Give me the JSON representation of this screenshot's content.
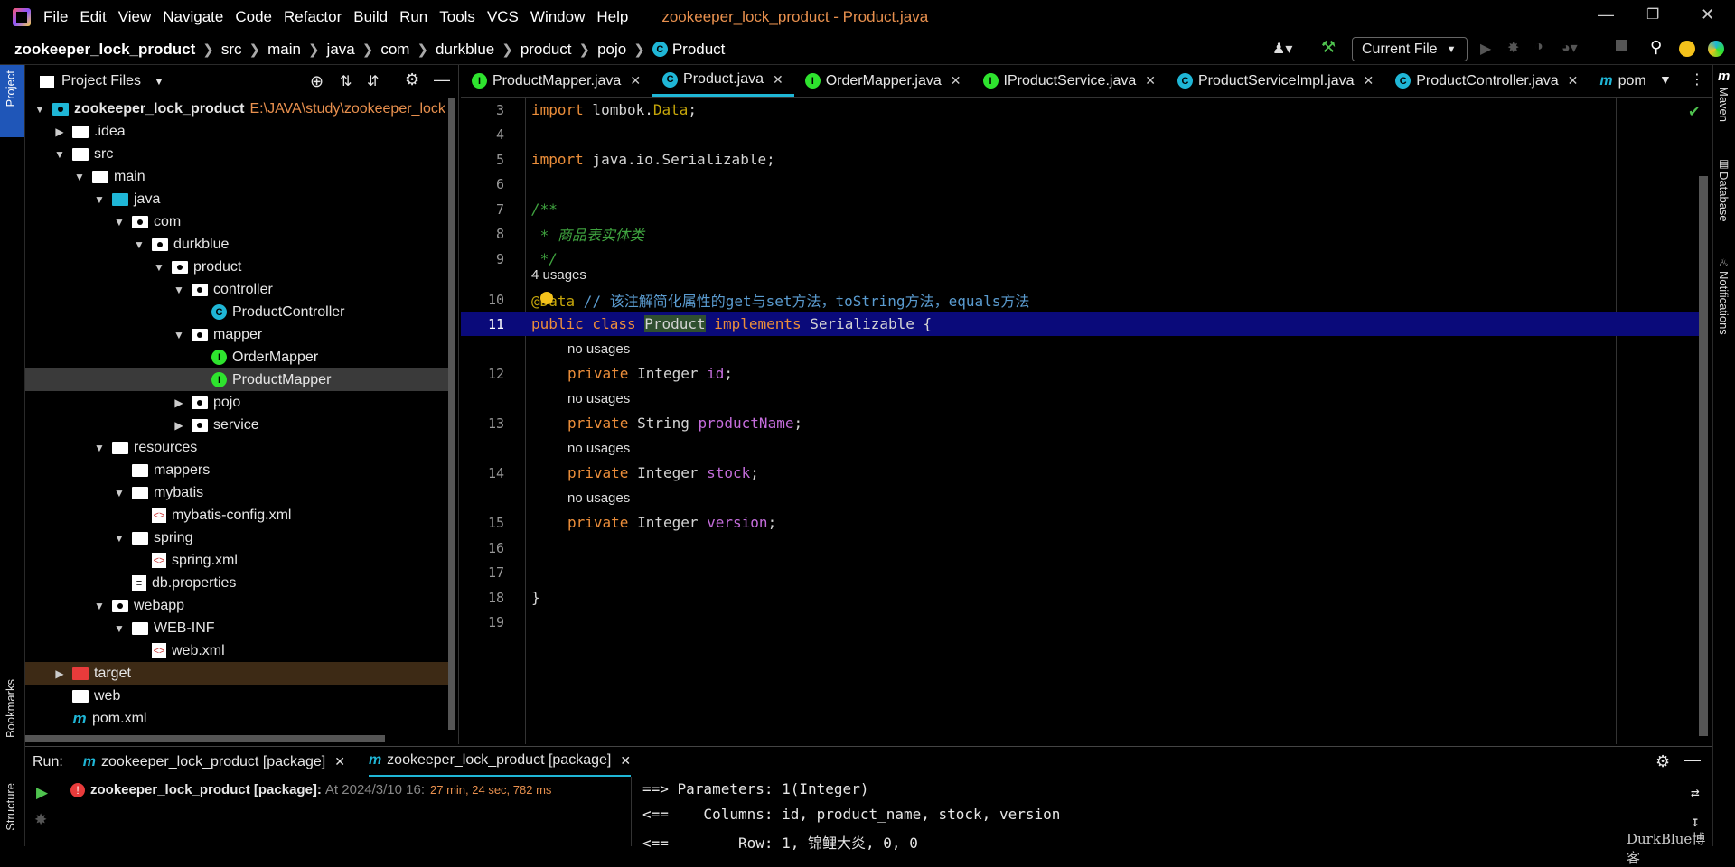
{
  "titlebar": {
    "menu": [
      "File",
      "Edit",
      "View",
      "Navigate",
      "Code",
      "Refactor",
      "Build",
      "Run",
      "Tools",
      "VCS",
      "Window",
      "Help"
    ],
    "title": "zookeeper_lock_product - Product.java"
  },
  "navbar": {
    "crumbs": [
      "zookeeper_lock_product",
      "src",
      "main",
      "java",
      "com",
      "durkblue",
      "product",
      "pojo",
      "Product"
    ],
    "run_config": "Current File"
  },
  "project": {
    "header": "Project Files",
    "root_path": "E:\\JAVA\\study\\zookeeper_lock",
    "items": [
      {
        "label": "zookeeper_lock_product"
      },
      {
        "label": ".idea"
      },
      {
        "label": "src"
      },
      {
        "label": "main"
      },
      {
        "label": "java"
      },
      {
        "label": "com"
      },
      {
        "label": "durkblue"
      },
      {
        "label": "product"
      },
      {
        "label": "controller"
      },
      {
        "label": "ProductController"
      },
      {
        "label": "mapper"
      },
      {
        "label": "OrderMapper"
      },
      {
        "label": "ProductMapper"
      },
      {
        "label": "pojo"
      },
      {
        "label": "service"
      },
      {
        "label": "resources"
      },
      {
        "label": "mappers"
      },
      {
        "label": "mybatis"
      },
      {
        "label": "mybatis-config.xml"
      },
      {
        "label": "spring"
      },
      {
        "label": "spring.xml"
      },
      {
        "label": "db.properties"
      },
      {
        "label": "webapp"
      },
      {
        "label": "WEB-INF"
      },
      {
        "label": "web.xml"
      },
      {
        "label": "target"
      },
      {
        "label": "web"
      },
      {
        "label": "pom.xml"
      }
    ]
  },
  "tabs": [
    "ProductMapper.java",
    "Product.java",
    "OrderMapper.java",
    "IProductService.java",
    "ProductServiceImpl.java",
    "ProductController.java",
    "pom."
  ],
  "editor": {
    "line_numbers": [
      "3",
      "4",
      "5",
      "6",
      "7",
      "8",
      "9",
      "10",
      "11",
      "12",
      "13",
      "14",
      "15",
      "16",
      "17",
      "18",
      "19"
    ],
    "usages_4": "4 usages",
    "no_usages": "no usages",
    "l3_kw": "import",
    "l3_rest": " lombok.",
    "l3_data": "Data",
    "l3_end": ";",
    "l5_kw": "import",
    "l5_rest": " java.io.Serializable;",
    "l7": "/**",
    "l8": " * 商品表实体类",
    "l9": " */",
    "l10_ann": "@Data",
    "l10_cm": " // 该注解简化属性的get与set方法，toString方法，equals方法",
    "l11_kw1": "public class ",
    "l11_cls": "Product",
    "l11_kw2": " implements ",
    "l11_rest": "Serializable {",
    "f_private": "private ",
    "f12_type": "Integer ",
    "f12_name": "id",
    "f13_type": "String ",
    "f13_name": "productName",
    "f14_type": "Integer ",
    "f14_name": "stock",
    "f15_type": "Integer ",
    "f15_name": "version",
    "semi": ";",
    "l18": "}"
  },
  "run": {
    "label": "Run:",
    "tabs": [
      "zookeeper_lock_product [package]",
      "zookeeper_lock_product [package]"
    ],
    "task": "zookeeper_lock_product [package]:",
    "task_time": "At 2024/3/10 16:",
    "task_duration": "27 min, 24 sec, 782 ms",
    "console": [
      "==> Parameters: 1(Integer)",
      "<==    Columns: id, product_name, stock, version",
      "<==        Row: 1, 锦鲤大炎, 0, 0"
    ]
  },
  "right_stripe": [
    "Maven",
    "Database",
    "Notifications"
  ],
  "left_stripe": [
    "Project",
    "Bookmarks",
    "Structure"
  ],
  "watermark": "DurkBlue博客"
}
